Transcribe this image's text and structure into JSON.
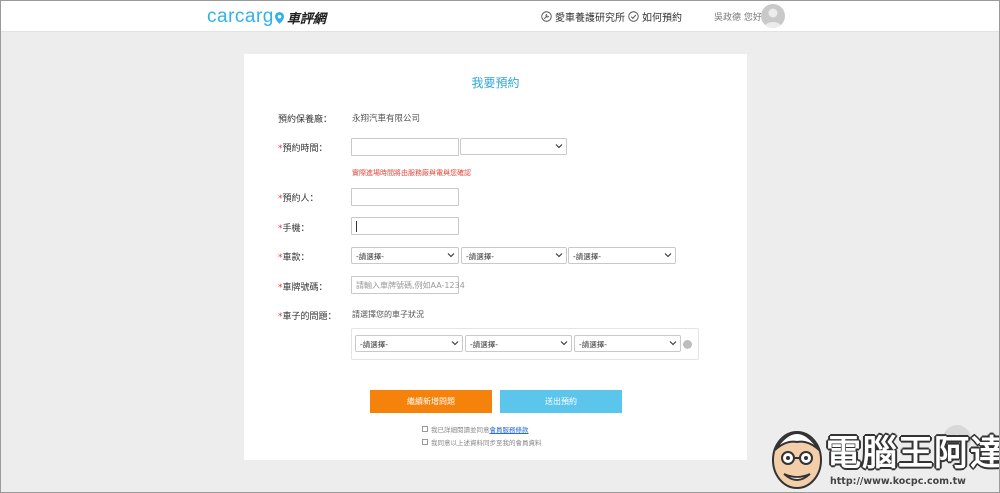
{
  "header": {
    "logo_word": "carcarg",
    "logo_cn": "車評網",
    "nav": [
      {
        "label": "愛車養護研究所",
        "icon": "wrench-circle-icon"
      },
      {
        "label": "如何預約",
        "icon": "check-circle-icon"
      }
    ],
    "greeting": "吳政德 您好"
  },
  "form": {
    "title": "我要預約",
    "shop_label": "預約保養廠：",
    "shop_value": "永翔汽車有限公司",
    "time_label": "預約時間：",
    "time_note": "實際進場時間將由服務廠與電與您確認",
    "person_label": "預約人：",
    "phone_label": "手機：",
    "car_label": "車款：",
    "car_selects": [
      "-請選擇-",
      "-請選擇-",
      "-請選擇-"
    ],
    "plate_label": "車牌號碼：",
    "plate_placeholder": "請輸入車牌號碼,例如AA-1234",
    "issue_label": "車子的問題：",
    "issue_hint": "請選擇您的車子狀況",
    "issue_selects": [
      "-請選擇-",
      "-請選擇-",
      "-請選擇-"
    ],
    "required_mark": "*",
    "add_button": "繼續新增問題",
    "submit_button": "送出預約",
    "agree_1_text": "我已詳細閱讀並同意",
    "agree_1_link": "會員服務條款",
    "agree_2_text": "我同意以上述資料同步至我的會員資料"
  },
  "watermark": {
    "text": "電腦王阿達",
    "url": "http://www.kocpc.com.tw"
  },
  "colors": {
    "accent_blue": "#2fa6dc",
    "orange": "#f5820b",
    "light_blue": "#5bc5ec",
    "required_red": "#e53935"
  }
}
